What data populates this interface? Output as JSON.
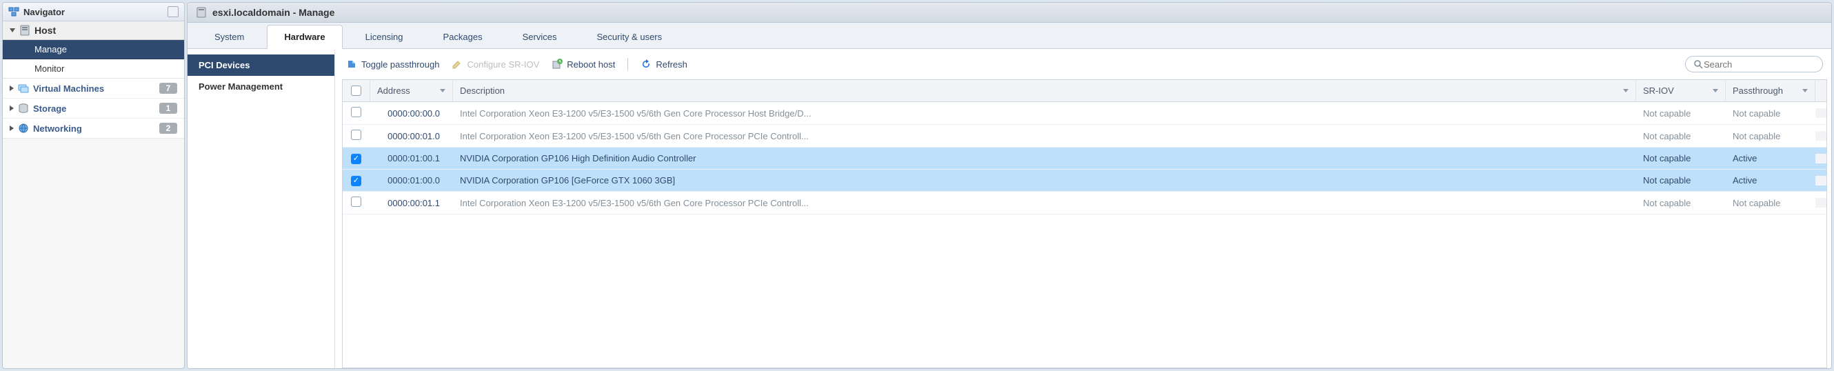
{
  "navigator": {
    "title": "Navigator",
    "host_label": "Host",
    "sub_items": [
      {
        "label": "Manage",
        "active": true
      },
      {
        "label": "Monitor",
        "active": false
      }
    ],
    "items": [
      {
        "label": "Virtual Machines",
        "count": "7",
        "icon": "vm"
      },
      {
        "label": "Storage",
        "count": "1",
        "icon": "storage"
      },
      {
        "label": "Networking",
        "count": "2",
        "icon": "network"
      }
    ]
  },
  "header": {
    "title": "esxi.localdomain - Manage"
  },
  "tabs": [
    {
      "label": "System"
    },
    {
      "label": "Hardware",
      "active": true
    },
    {
      "label": "Licensing"
    },
    {
      "label": "Packages"
    },
    {
      "label": "Services"
    },
    {
      "label": "Security & users"
    }
  ],
  "sub_sidebar": [
    {
      "label": "PCI Devices",
      "active": true
    },
    {
      "label": "Power Management",
      "active": false
    }
  ],
  "toolbar": {
    "toggle_passthrough": "Toggle passthrough",
    "configure_sriov": "Configure SR-IOV",
    "reboot_host": "Reboot host",
    "refresh": "Refresh",
    "search_placeholder": "Search"
  },
  "grid": {
    "columns": {
      "address": "Address",
      "description": "Description",
      "sriov": "SR-IOV",
      "passthrough": "Passthrough"
    },
    "rows": [
      {
        "checked": false,
        "address": "0000:00:00.0",
        "description": "Intel Corporation Xeon E3-1200 v5/E3-1500 v5/6th Gen Core Processor Host Bridge/D...",
        "sriov": "Not capable",
        "passthrough": "Not capable",
        "selected": false
      },
      {
        "checked": false,
        "address": "0000:00:01.0",
        "description": "Intel Corporation Xeon E3-1200 v5/E3-1500 v5/6th Gen Core Processor PCIe Controll...",
        "sriov": "Not capable",
        "passthrough": "Not capable",
        "selected": false
      },
      {
        "checked": true,
        "address": "0000:01:00.1",
        "description": "NVIDIA Corporation GP106 High Definition Audio Controller",
        "sriov": "Not capable",
        "passthrough": "Active",
        "selected": true
      },
      {
        "checked": true,
        "address": "0000:01:00.0",
        "description": "NVIDIA Corporation GP106 [GeForce GTX 1060 3GB]",
        "sriov": "Not capable",
        "passthrough": "Active",
        "selected": true
      },
      {
        "checked": false,
        "address": "0000:00:01.1",
        "description": "Intel Corporation Xeon E3-1200 v5/E3-1500 v5/6th Gen Core Processor PCIe Controll...",
        "sriov": "Not capable",
        "passthrough": "Not capable",
        "selected": false
      }
    ]
  }
}
